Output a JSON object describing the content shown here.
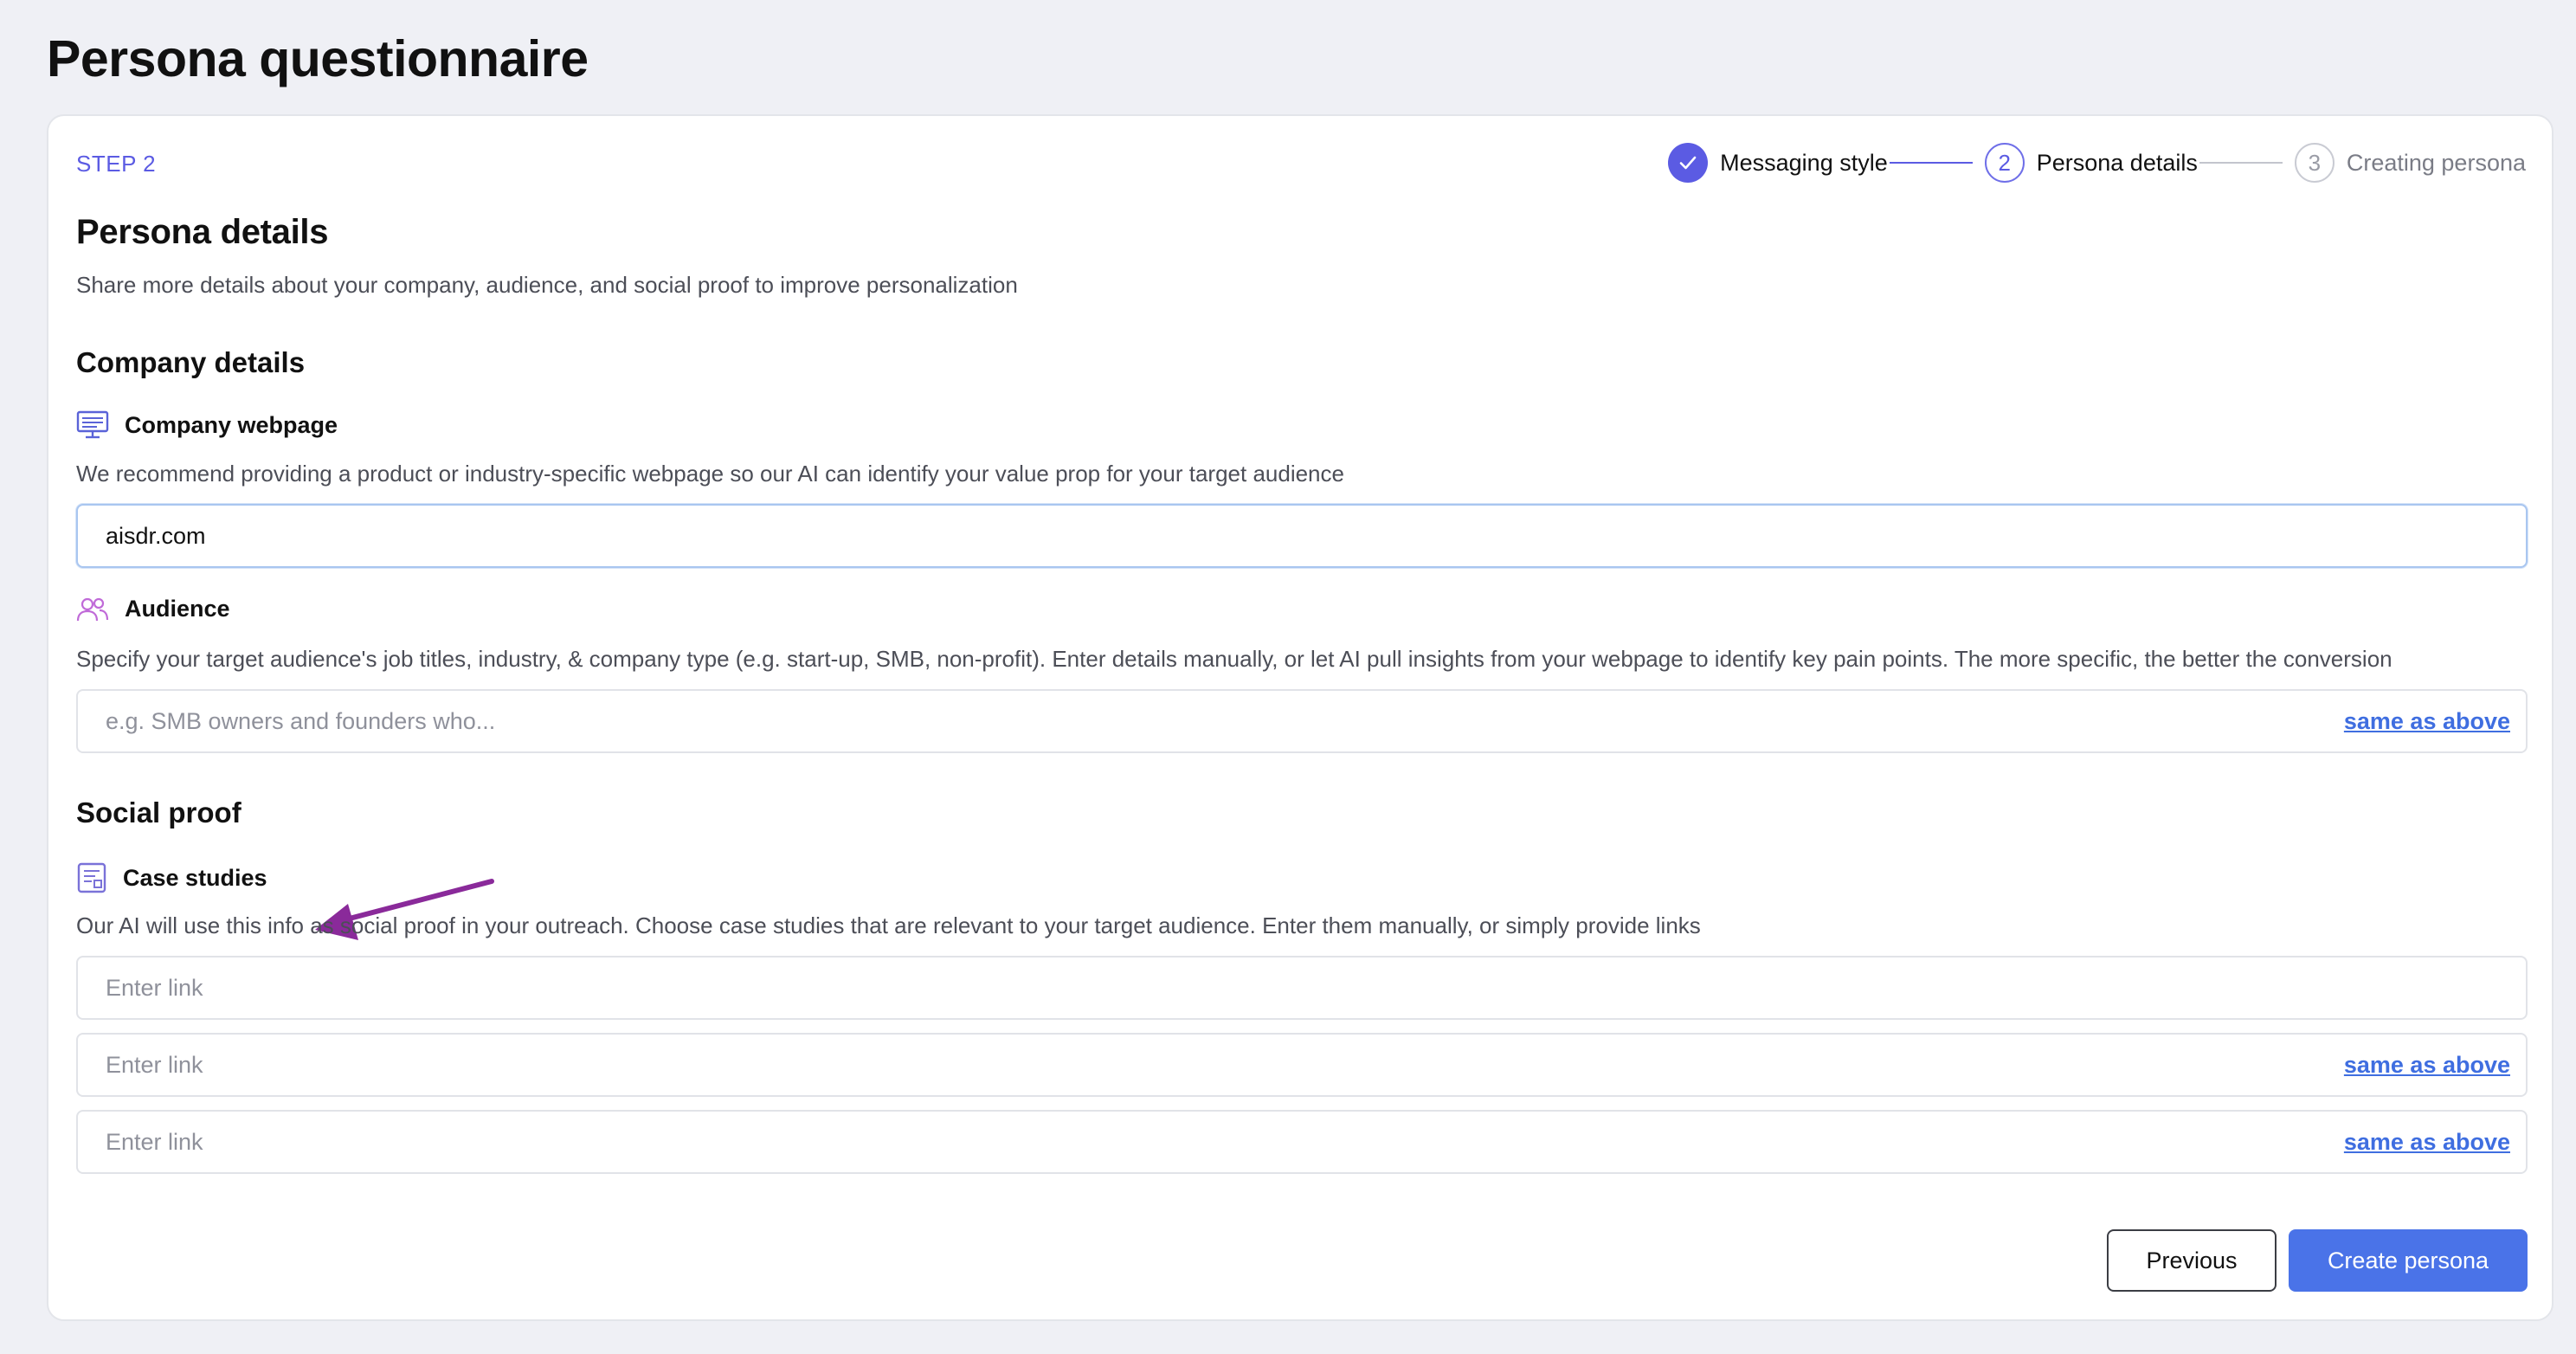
{
  "page": {
    "title": "Persona questionnaire"
  },
  "step_label": "STEP 2",
  "stepper": {
    "steps": [
      {
        "number": "",
        "label": "Messaging style",
        "state": "done"
      },
      {
        "number": "2",
        "label": "Persona details",
        "state": "active"
      },
      {
        "number": "3",
        "label": "Creating persona",
        "state": "todo"
      }
    ]
  },
  "header": {
    "title": "Persona details",
    "description": "Share more details about your company, audience, and social proof to improve personalization"
  },
  "company_details": {
    "title": "Company details",
    "webpage": {
      "label": "Company webpage",
      "icon": "monitor-icon",
      "description": "We recommend providing a product or industry-specific webpage so our AI can identify your value prop for your target audience",
      "value": "aisdr.com"
    },
    "audience": {
      "label": "Audience",
      "icon": "users-icon",
      "description": "Specify your target audience's job titles, industry, & company type (e.g. start-up, SMB, non-profit). Enter details manually, or let AI pull insights from your webpage to identify key pain points. The more specific, the better the conversion",
      "placeholder": "e.g. SMB owners and founders who...",
      "link": "same as above"
    }
  },
  "social_proof": {
    "title": "Social proof",
    "case_studies": {
      "label": "Case studies",
      "icon": "document-icon",
      "description": "Our AI will use this info as social proof in your outreach. Choose case studies that are relevant to your target audience. Enter them manually, or simply provide links",
      "inputs": [
        {
          "placeholder": "Enter link",
          "link": ""
        },
        {
          "placeholder": "Enter link",
          "link": "same as above"
        },
        {
          "placeholder": "Enter link",
          "link": "same as above"
        }
      ]
    }
  },
  "buttons": {
    "previous": "Previous",
    "create": "Create persona"
  },
  "colors": {
    "accent": "#5b5be3",
    "primary_button": "#4a73e8",
    "link": "#3f6ee0",
    "annotation_arrow": "#8a2a9a"
  }
}
